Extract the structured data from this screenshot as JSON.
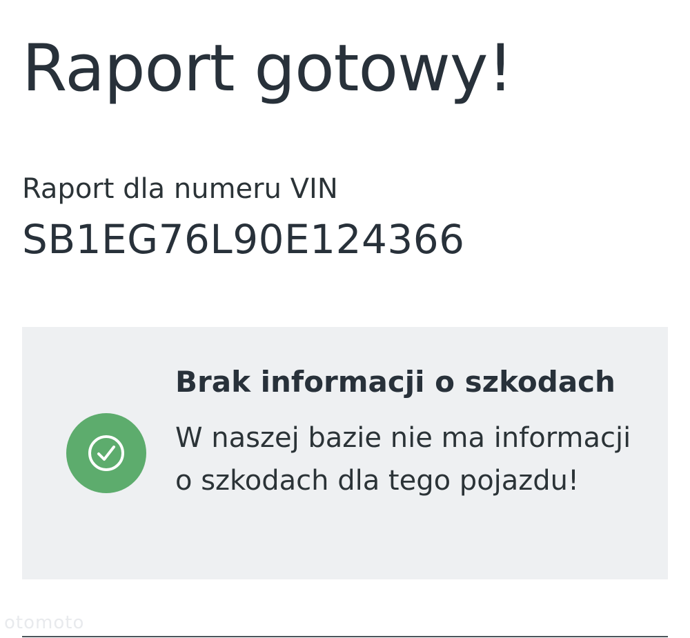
{
  "header": {
    "title": "Raport gotowy!"
  },
  "vin": {
    "label": "Raport dla numeru VIN",
    "number": "SB1EG76L90E124366"
  },
  "damage_card": {
    "icon": "check-circle-icon",
    "icon_color": "#5dac6d",
    "background_color": "#eef0f2",
    "heading": "Brak informacji o szkodach",
    "description": "W naszej bazie nie ma informacji o szkodach dla tego pojazdu!"
  },
  "watermark": {
    "text": "otomoto"
  }
}
